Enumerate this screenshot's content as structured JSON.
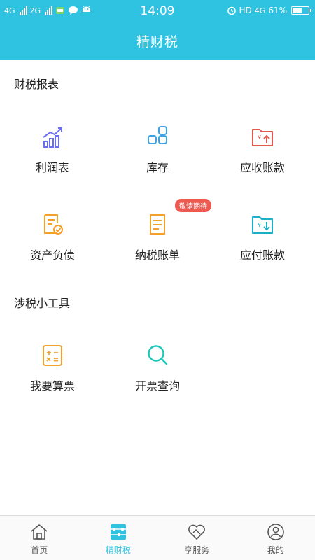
{
  "status_bar": {
    "sim1_label": "4G",
    "sim2_label": "2G",
    "time": "14:09",
    "hd_label": "HD",
    "net_label": "4G",
    "battery": "61%",
    "battery_level": 0.61
  },
  "header": {
    "title": "精财税"
  },
  "section_finance": {
    "title": "财税报表",
    "items": [
      {
        "label": "利润表",
        "icon": "bar-chart-icon"
      },
      {
        "label": "库存",
        "icon": "grid-blocks-icon"
      },
      {
        "label": "应收账款",
        "icon": "folder-yen-up-icon"
      },
      {
        "label": "资产负债",
        "icon": "document-check-icon"
      },
      {
        "label": "纳税账单",
        "icon": "document-lines-icon",
        "badge": "敬请期待"
      },
      {
        "label": "应付账款",
        "icon": "folder-yen-down-icon"
      }
    ]
  },
  "section_tools": {
    "title": "涉税小工具",
    "items": [
      {
        "label": "我要算票",
        "icon": "calculator-icon"
      },
      {
        "label": "开票查询",
        "icon": "search-icon"
      }
    ]
  },
  "tabbar": {
    "active_color": "#2fc2e1",
    "items": [
      {
        "label": "首页",
        "icon": "home-icon"
      },
      {
        "label": "精财税",
        "icon": "abacus-icon",
        "active": true
      },
      {
        "label": "享服务",
        "icon": "heart-handshake-icon"
      },
      {
        "label": "我的",
        "icon": "user-icon"
      }
    ]
  }
}
